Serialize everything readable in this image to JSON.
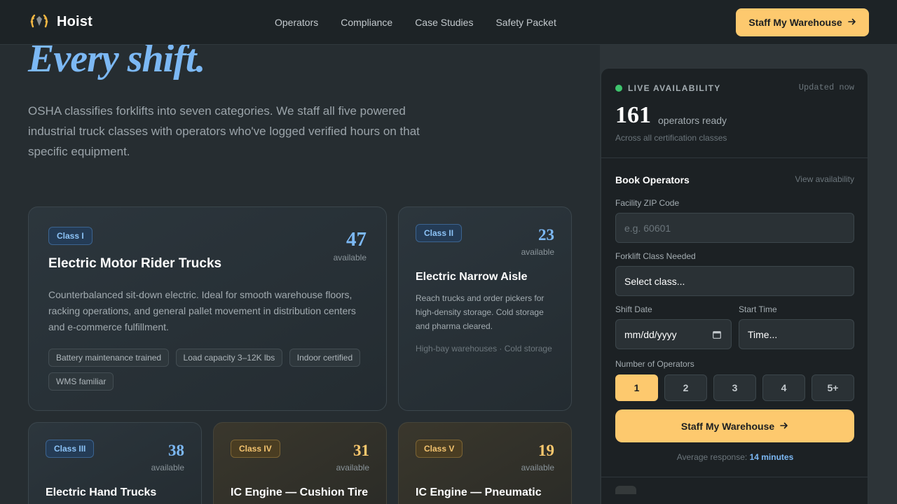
{
  "nav": {
    "brand": "Hoist",
    "links": [
      "Operators",
      "Compliance",
      "Case Studies",
      "Safety Packet"
    ],
    "cta": "Staff My Warehouse"
  },
  "hero": {
    "title": "Every shift.",
    "subtitle": "OSHA classifies forklifts into seven categories. We staff all five powered industrial truck classes with operators who've logged verified hours on that specific equipment."
  },
  "cards": [
    {
      "badge": "Class I",
      "count": "47",
      "available_label": "available",
      "title": "Electric Motor Rider Trucks",
      "description": "Counterbalanced sit-down electric. Ideal for smooth warehouse floors, racking operations, and general pallet movement in distribution centers and e-commerce fulfillment.",
      "chips": [
        "Battery maintenance trained",
        "Load capacity 3–12K lbs",
        "Indoor certified",
        "WMS familiar"
      ]
    },
    {
      "badge": "Class II",
      "count": "23",
      "available_label": "available",
      "title": "Electric Narrow Aisle",
      "description": "Reach trucks and order pickers for high-density storage. Cold storage and pharma cleared.",
      "footnote": "High-bay warehouses · Cold storage"
    },
    {
      "badge": "Class III",
      "count": "38",
      "available_label": "available",
      "title": "Electric Hand Trucks"
    },
    {
      "badge": "Class IV",
      "count": "31",
      "available_label": "available",
      "title": "IC Engine — Cushion Tire"
    },
    {
      "badge": "Class V",
      "count": "19",
      "available_label": "available",
      "title": "IC Engine — Pneumatic"
    }
  ],
  "panel": {
    "live_label": "LIVE AVAILABILITY",
    "updated": "Updated now",
    "ready_count": "161",
    "ready_label": "operators ready",
    "across": "Across all certification classes",
    "book_title": "Book Operators",
    "view_link": "View availability",
    "zip_label": "Facility ZIP Code",
    "zip_placeholder": "e.g. 60601",
    "class_label": "Forklift Class Needed",
    "class_value": "Select class...",
    "date_label": "Shift Date",
    "date_value": "mm/dd/yyyy",
    "time_label": "Start Time",
    "time_value": "Time...",
    "operators_label": "Number of Operators",
    "operator_options": [
      "1",
      "2",
      "3",
      "4",
      "5+"
    ],
    "selected_operator": "1",
    "submit": "Staff My Warehouse",
    "avg_prefix": "Average response:",
    "avg_value": "14 minutes"
  },
  "colors": {
    "accent_blue": "#7cb8f4",
    "accent_amber": "#fdc96e",
    "live_green": "#3ec46d"
  }
}
